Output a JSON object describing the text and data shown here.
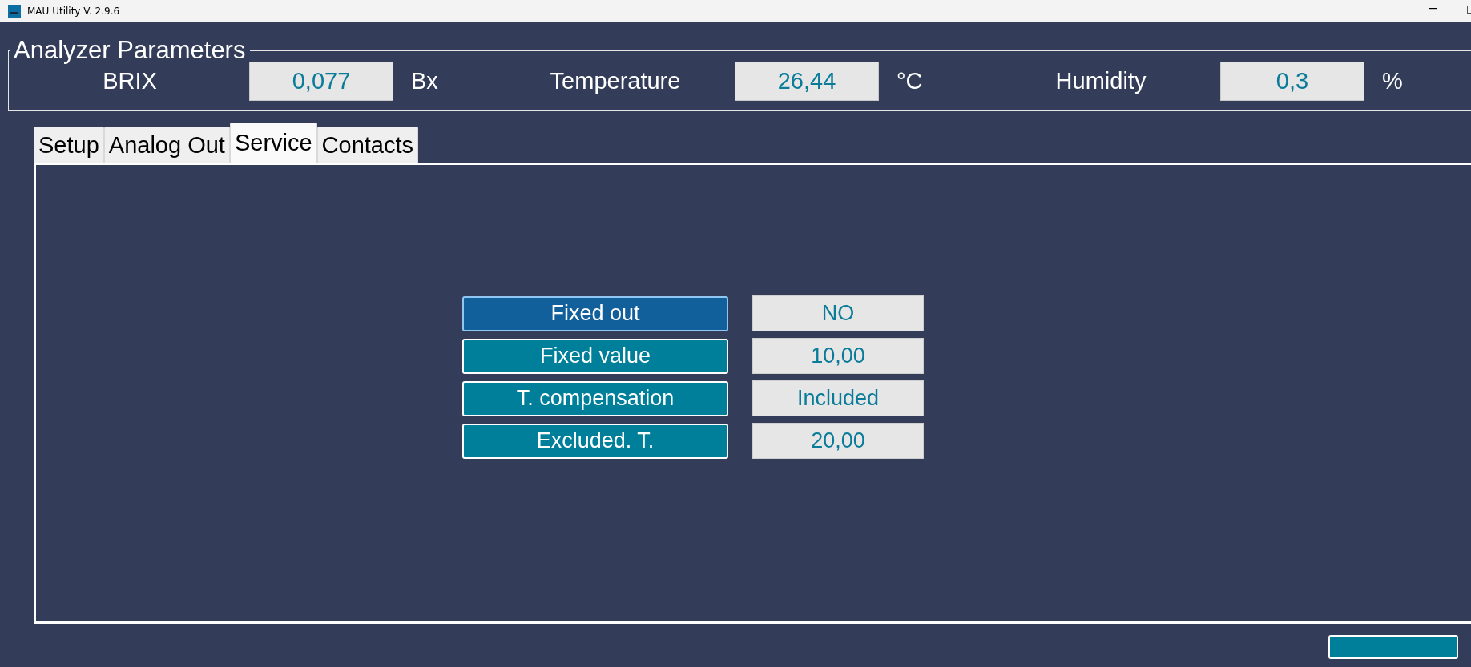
{
  "window": {
    "title": "MAU Utility V. 2.9.6"
  },
  "analyzer_parameters": {
    "title": "Analyzer Parameters",
    "measures": [
      {
        "label": "BRIX",
        "value": "0,077",
        "unit": "Bx"
      },
      {
        "label": "Temperature",
        "value": "26,44",
        "unit": "°C"
      },
      {
        "label": "Humidity",
        "value": "0,3",
        "unit": "%"
      }
    ]
  },
  "tabs": [
    {
      "label": "Setup",
      "selected": false
    },
    {
      "label": "Analog Out",
      "selected": false
    },
    {
      "label": "Service",
      "selected": true
    },
    {
      "label": "Contacts",
      "selected": false
    }
  ],
  "service_rows": [
    {
      "label": "Fixed out",
      "value": "NO",
      "selected": true
    },
    {
      "label": "Fixed value",
      "value": "10,00",
      "selected": false
    },
    {
      "label": "T. compensation",
      "value": "Included",
      "selected": false
    },
    {
      "label": "Excluded. T.",
      "value": "20,00",
      "selected": false
    }
  ]
}
